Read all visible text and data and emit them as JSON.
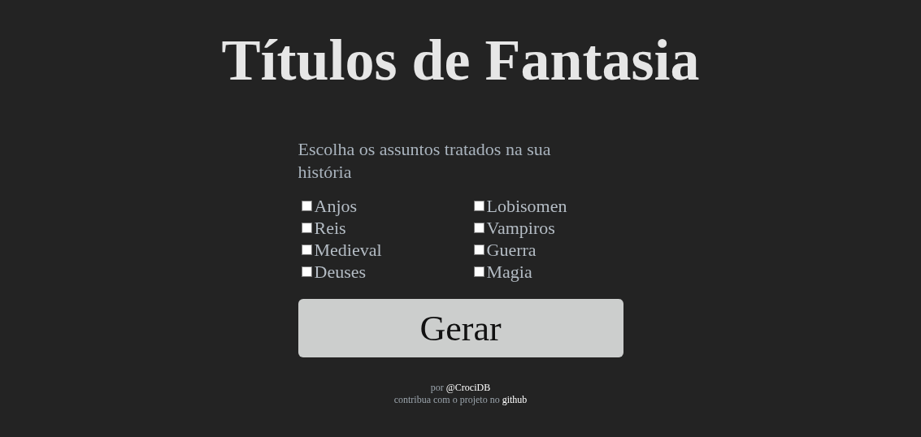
{
  "title": "Títulos de Fantasia",
  "prompt": "Escolha os assuntos tratados na sua história",
  "topic_columns": [
    [
      {
        "label": "Anjos",
        "checked": false
      },
      {
        "label": "Reis",
        "checked": false
      },
      {
        "label": "Medieval",
        "checked": false
      },
      {
        "label": "Deuses",
        "checked": false
      }
    ],
    [
      {
        "label": "Lobisomen",
        "checked": false
      },
      {
        "label": "Vampiros",
        "checked": false
      },
      {
        "label": "Guerra",
        "checked": false
      },
      {
        "label": "Magia",
        "checked": false
      }
    ]
  ],
  "button": "Gerar",
  "footer": [
    {
      "text": "por",
      "link": "@CrociDB"
    },
    {
      "text": "contribua com o projeto no",
      "link": "github"
    }
  ]
}
